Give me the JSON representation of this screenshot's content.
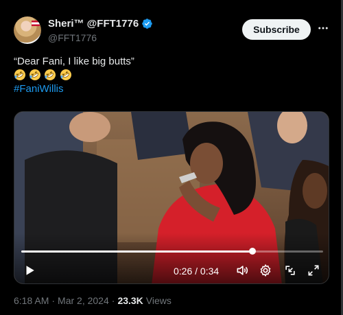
{
  "author": {
    "display_name": "Sheri™ @FFT1776",
    "handle": "@FFT1776",
    "avatar_icon": "profile-photo"
  },
  "actions": {
    "subscribe_label": "Subscribe",
    "more_icon": "more-horizontal-icon"
  },
  "tweet": {
    "text_line": "“Dear Fani, I like big butts”",
    "emoji_icon": "rolling-on-floor-laughing-emoji",
    "emoji_count": 4,
    "hashtag": "#FaniWillis"
  },
  "video": {
    "time": "0:26 / 0:34",
    "progress": 0.765,
    "controls": [
      "play-icon",
      "volume-icon",
      "settings-icon",
      "minimize-icon",
      "fullscreen-icon"
    ]
  },
  "meta": {
    "time": "6:18 AM",
    "separator": "·",
    "date": "Mar 2, 2024",
    "views_count": "23.3K",
    "views_label": "Views"
  },
  "colors": {
    "background": "#000000",
    "text": "#e7e9ea",
    "muted": "#71767b",
    "link": "#1d9bf0",
    "verified": "#1d9bf0"
  }
}
